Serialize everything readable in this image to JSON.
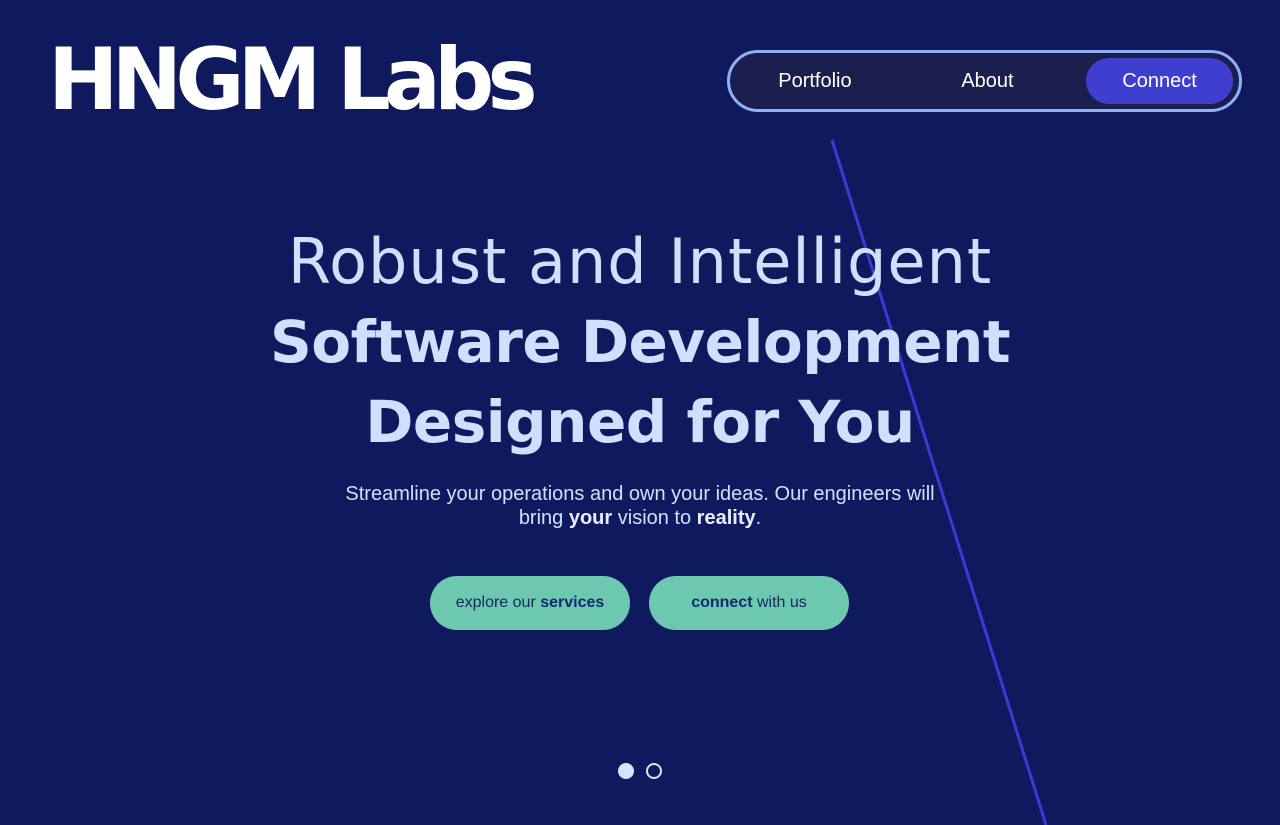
{
  "brand": {
    "logo_text": "HNGM Labs"
  },
  "nav": {
    "items": [
      {
        "label": "Portfolio"
      },
      {
        "label": "About"
      },
      {
        "label": "Connect"
      }
    ],
    "active": "Connect"
  },
  "hero": {
    "line1": "Robust and Intelligent",
    "line2": "Software Development",
    "line3": "Designed for You"
  },
  "subtitle": {
    "part1": "Streamline your operations and own your ideas. Our engineers will bring ",
    "bold1": "your",
    "part2": " vision to ",
    "bold2": "reality",
    "part3": "."
  },
  "cta": {
    "services": {
      "prefix": "explore our ",
      "bold": "services"
    },
    "connect": {
      "bold": "connect",
      "suffix": " with us"
    }
  },
  "carousel": {
    "slides": 2,
    "active_index": 0
  },
  "colors": {
    "background": "#0f1a5e",
    "accent": "#3e3fcf",
    "cta": "#6cc9b0",
    "hero_text": "#cfe0ff",
    "nav_border": "#8fb0f5"
  }
}
